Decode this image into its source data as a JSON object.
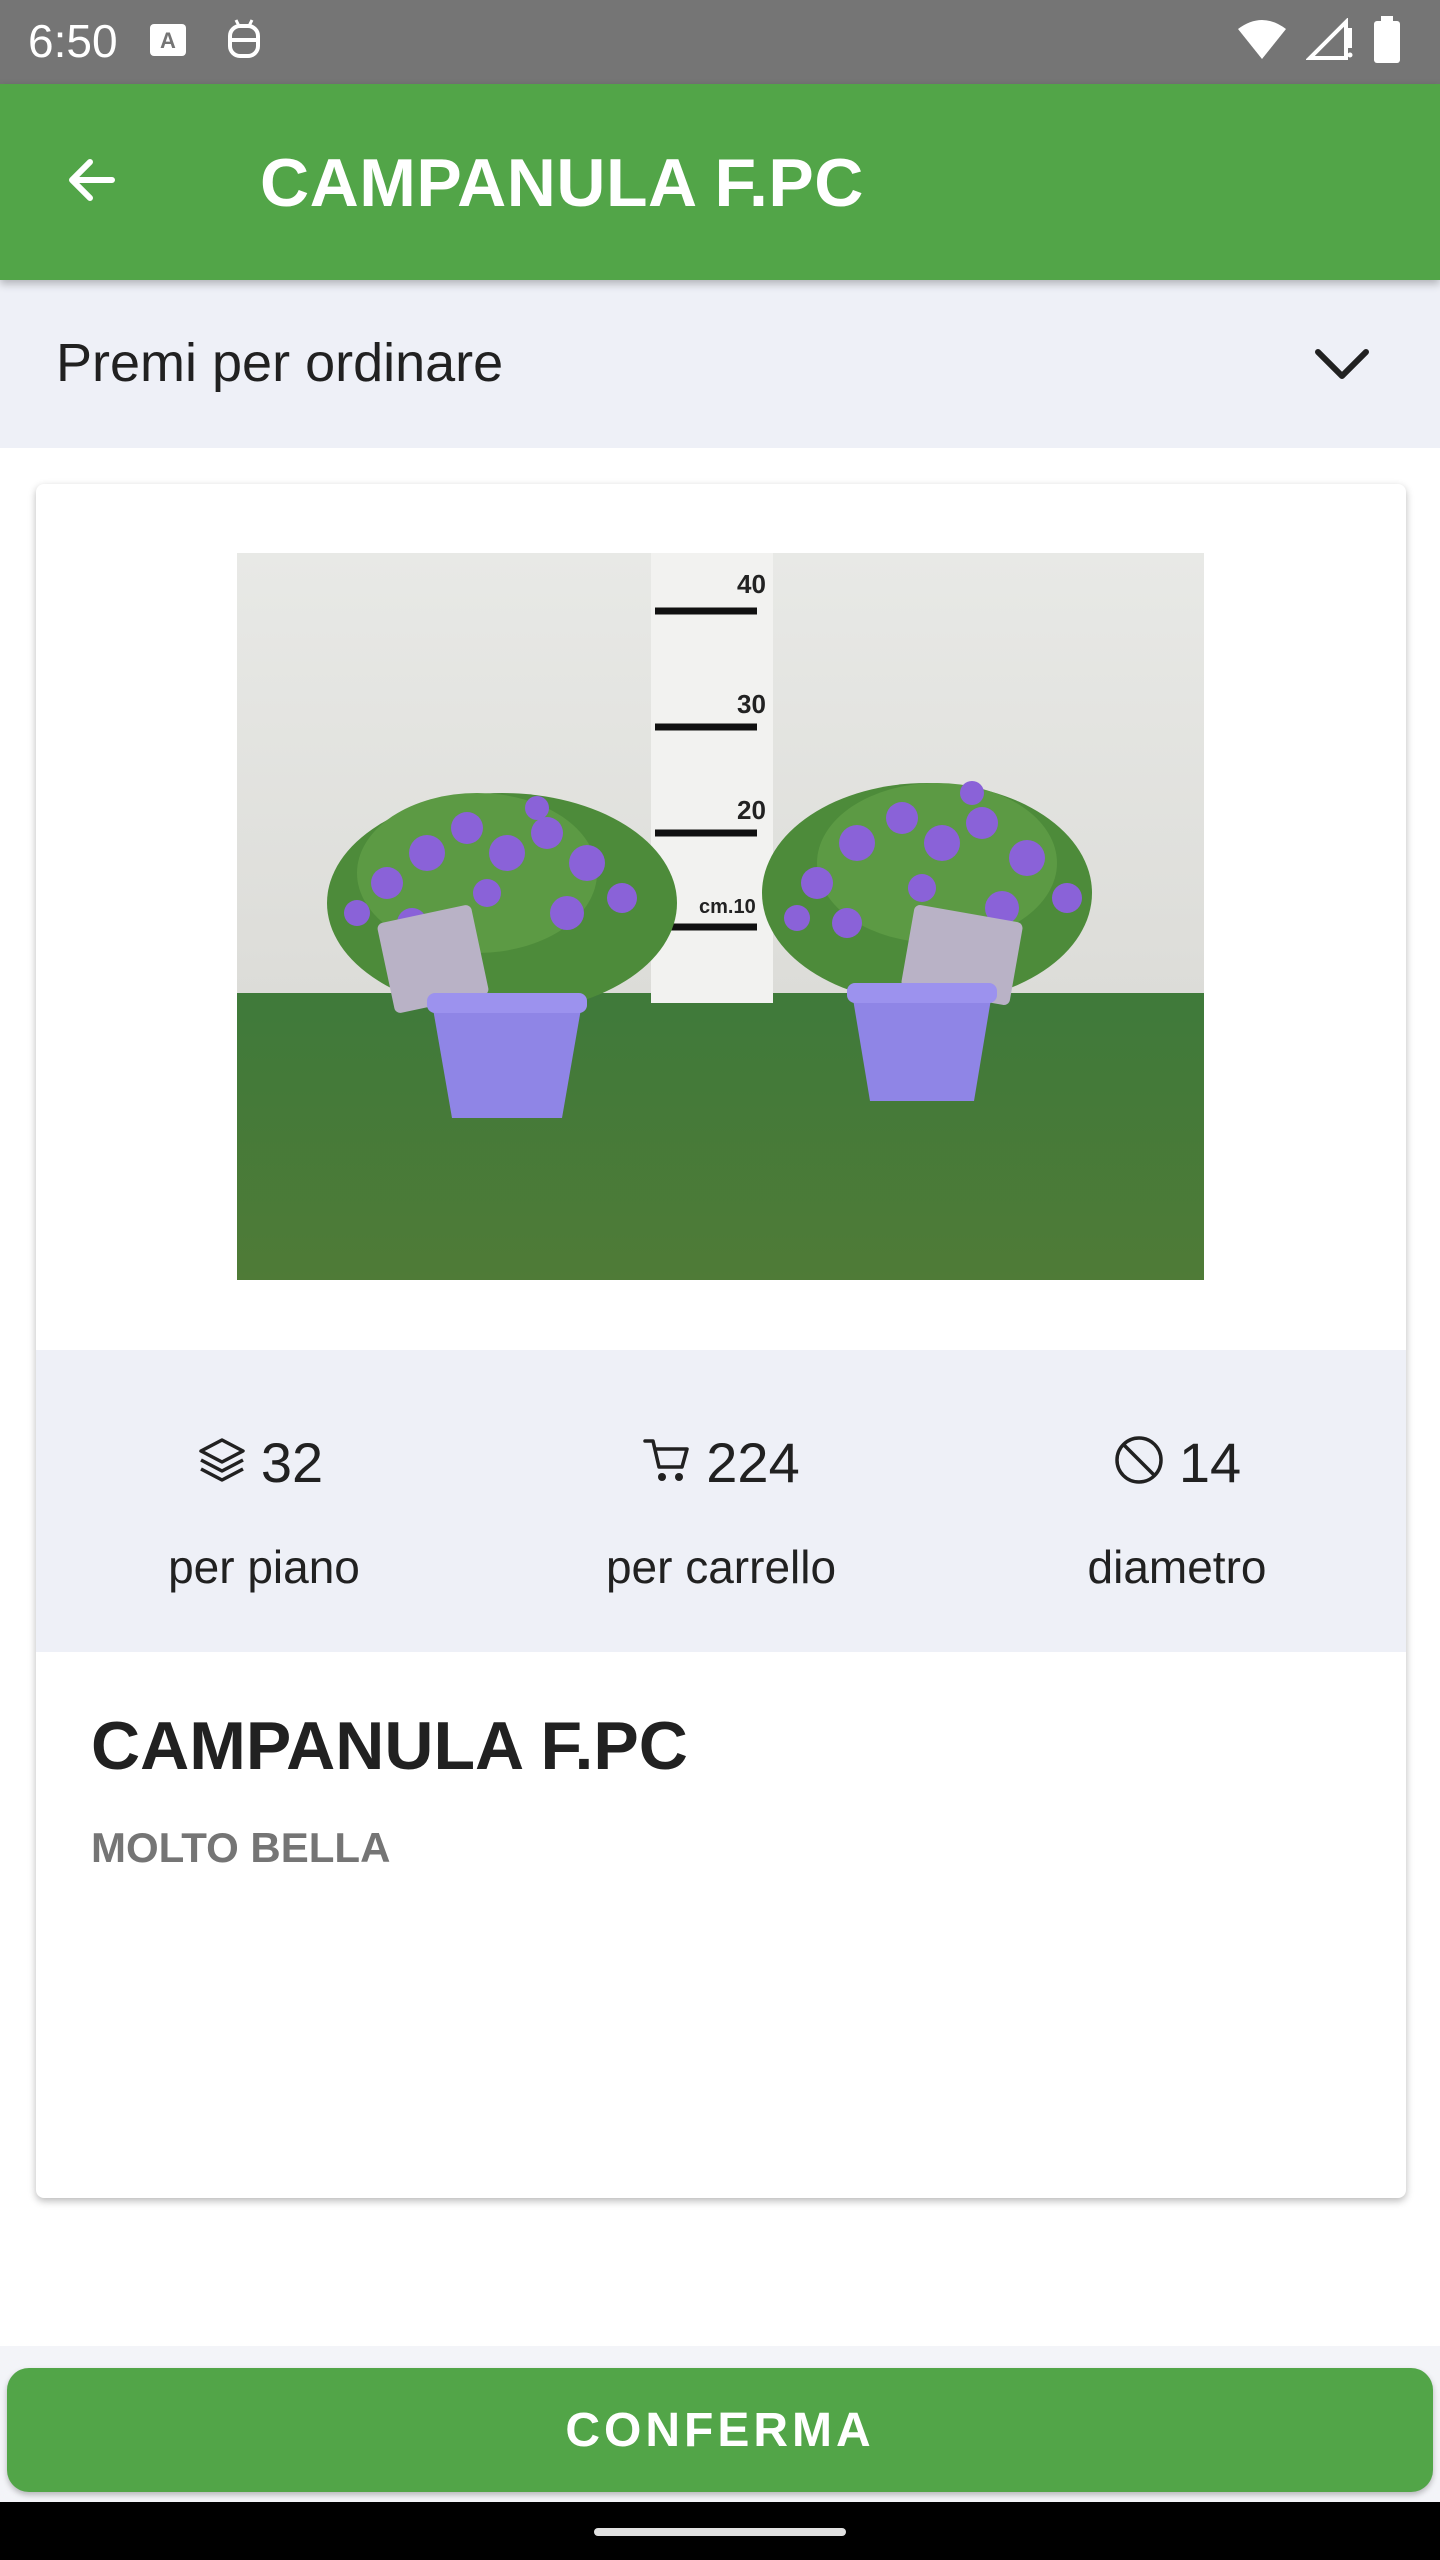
{
  "status_bar": {
    "time": "6:50",
    "left_icons": [
      "a-keyboard-icon",
      "android-icon"
    ],
    "right_icons": [
      "wifi-icon",
      "signal-icon",
      "battery-icon"
    ]
  },
  "app_bar": {
    "title": "CAMPANULA F.PC",
    "back_icon": "arrow-left-icon",
    "color": "#52a548"
  },
  "order_bar": {
    "label": "Premi per ordinare",
    "icon": "chevron-down-icon"
  },
  "product": {
    "image_marks": [
      "40",
      "30",
      "20",
      "cm.10"
    ],
    "stats": [
      {
        "icon": "layers-icon",
        "value": "32",
        "label": "per piano"
      },
      {
        "icon": "cart-icon",
        "value": "224",
        "label": "per carrello"
      },
      {
        "icon": "diameter-icon",
        "value": "14",
        "label": "diametro"
      }
    ],
    "name": "CAMPANULA F.PC",
    "subtitle": "MOLTO BELLA"
  },
  "actions": {
    "confirm_label": "CONFERMA"
  },
  "colors": {
    "accent": "#52a548",
    "panel": "#eef0f7"
  }
}
